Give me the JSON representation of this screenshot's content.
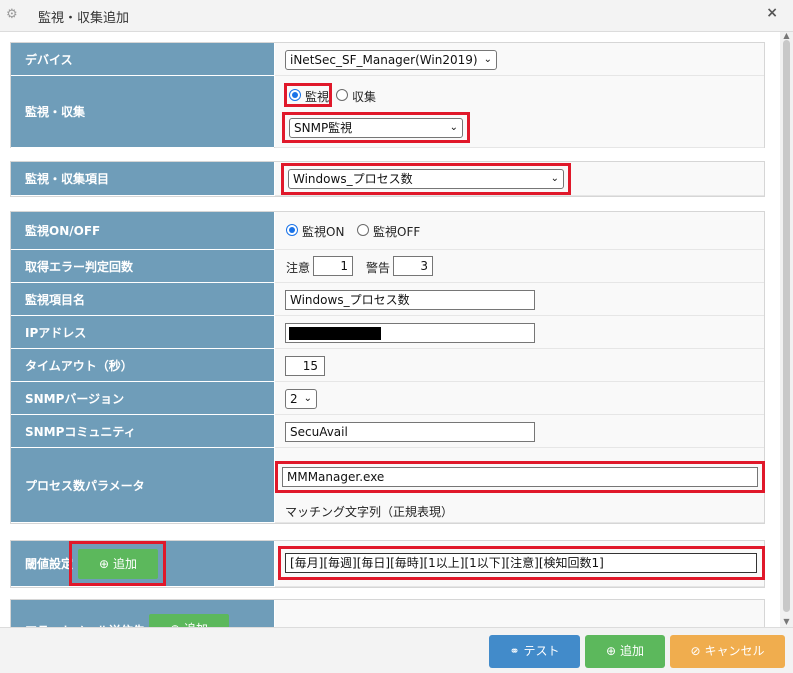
{
  "window": {
    "title": "監視・収集追加",
    "close_glyph": "×"
  },
  "form": {
    "device": {
      "label": "デバイス",
      "value": "iNetSec_SF_Manager(Win2019)"
    },
    "monitor_collect": {
      "label": "監視・収集",
      "options": [
        "監視",
        "収集"
      ],
      "selected": "監視",
      "method": "SNMP監視"
    },
    "item": {
      "label": "監視・収集項目",
      "value": "Windows_プロセス数"
    },
    "monitor_onoff": {
      "label": "監視ON/OFF",
      "on_label": "監視ON",
      "off_label": "監視OFF",
      "selected": "監視ON"
    },
    "error_count": {
      "label": "取得エラー判定回数",
      "caution_label": "注意",
      "caution_value": "1",
      "warning_label": "警告",
      "warning_value": "3"
    },
    "item_name": {
      "label": "監視項目名",
      "value": "Windows_プロセス数"
    },
    "ip_address": {
      "label": "IPアドレス",
      "value": ""
    },
    "timeout": {
      "label": "タイムアウト（秒）",
      "value": "15"
    },
    "snmp_version": {
      "label": "SNMPバージョン",
      "value": "2"
    },
    "snmp_community": {
      "label": "SNMPコミュニティ",
      "value": "SecuAvail"
    },
    "process_param": {
      "label": "プロセス数パラメータ",
      "value": "MMManager.exe",
      "hint": "マッチング文字列（正規表現）"
    },
    "threshold": {
      "label": "閾値設定",
      "add_label": "追加",
      "entry": "[毎月][毎週][毎日][毎時][1以上][1以下][注意][検知回数1]"
    },
    "next_section": {
      "label": "アラートメール送信先",
      "add_label": "追加"
    }
  },
  "footer": {
    "test_label": "テスト",
    "add_label": "追加",
    "cancel_label": "キャンセル"
  },
  "colors": {
    "label_bg": "#6f9db9",
    "highlight": "#e0182a",
    "test_btn": "#428bca",
    "add_btn": "#5cb85c",
    "cancel_btn": "#f0ad4e"
  }
}
